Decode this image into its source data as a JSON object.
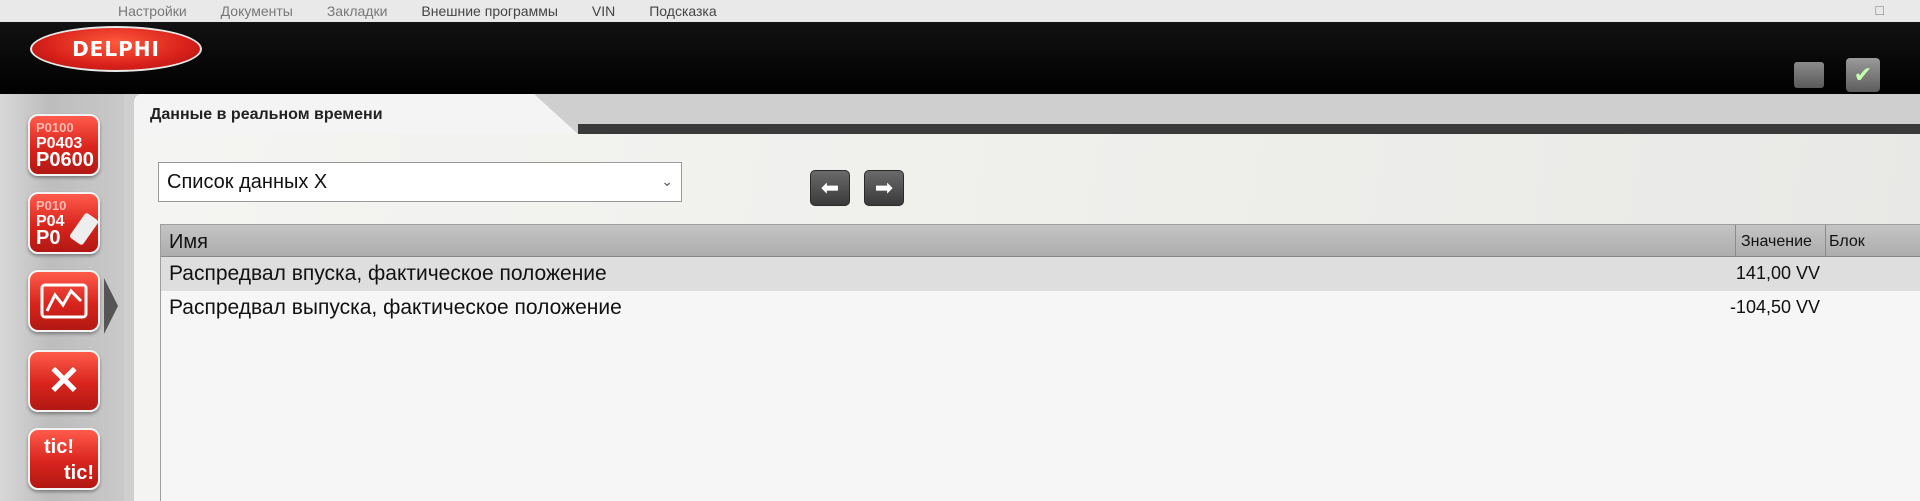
{
  "menu": {
    "items": [
      "Настройки",
      "Документы",
      "Закладки",
      "Внешние программы",
      "VIN",
      "Подсказка"
    ],
    "window_control": "□"
  },
  "brand": {
    "logo_text": "DELPHI",
    "accent_color": "#d8201a"
  },
  "sidebar": {
    "dtc_button": {
      "codes": [
        "P0100",
        "P0403",
        "P0600"
      ]
    },
    "dtc_clear_button": {
      "codes": [
        "P010",
        "P04",
        "P0"
      ]
    },
    "tic_button": {
      "line1": "tic!",
      "line2": "tic!"
    }
  },
  "tab": {
    "title": "Данные в реальном времени"
  },
  "list_selector": {
    "value": "Список данных X"
  },
  "table": {
    "columns": [
      "Имя",
      "Значение",
      "Блок"
    ],
    "rows": [
      {
        "name": "Распредвал впуска, фактическое положение",
        "value": "141,00 VV"
      },
      {
        "name": "Распредвал выпуска, фактическое положение",
        "value": "-104,50 VV"
      }
    ]
  }
}
